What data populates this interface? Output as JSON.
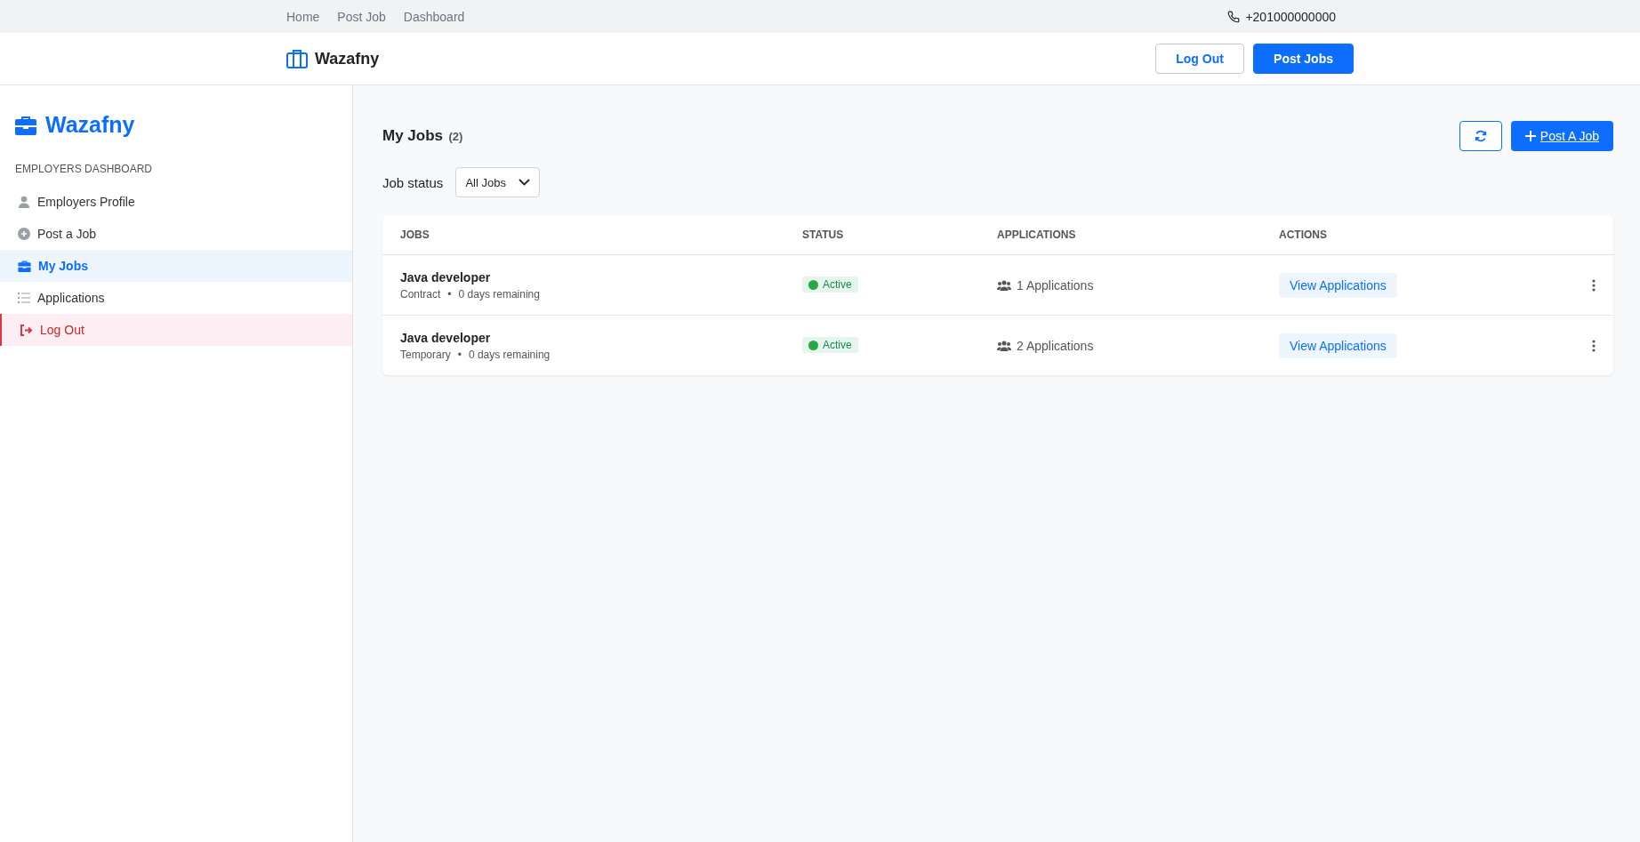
{
  "top_bar": {
    "links": [
      "Home",
      "Post Job",
      "Dashboard"
    ],
    "phone": "+201000000000"
  },
  "header": {
    "brand": "Wazafny",
    "buttons": [
      {
        "label": "Log Out",
        "kind": "outline"
      },
      {
        "label": "Post Jobs",
        "kind": "primary"
      }
    ]
  },
  "sidebar": {
    "brand": "Wazafny",
    "section": "EMPLOYERS DASHBOARD",
    "items": [
      {
        "label": "Employers Profile",
        "kind": "profile",
        "selected": false
      },
      {
        "label": "Post a Job",
        "kind": "post",
        "selected": false
      },
      {
        "label": "My Jobs",
        "kind": "jobs",
        "selected": true
      },
      {
        "label": "Applications",
        "kind": "applications",
        "selected": false
      },
      {
        "label": "Log Out",
        "kind": "logout",
        "selected": false
      }
    ]
  },
  "main": {
    "title": "My Jobs",
    "count": "(2)",
    "post_button": "Post A Job",
    "filter": {
      "label": "Job status",
      "value": "All Jobs"
    },
    "table": {
      "columns": [
        "JOBS",
        "STATUS",
        "APPLICATIONS",
        "ACTIONS"
      ],
      "rows": [
        {
          "title": "Java developer",
          "type": "Contract",
          "separator": "•",
          "remaining": "0 days remaining",
          "status": {
            "label": "Active",
            "kind": "active"
          },
          "applications": "1 Applications",
          "action": "View Applications"
        },
        {
          "title": "Java developer",
          "type": "Temporary",
          "separator": "•",
          "remaining": "0 days remaining",
          "status": {
            "label": "Active",
            "kind": "active"
          },
          "applications": "2 Applications",
          "action": "View Applications"
        }
      ]
    }
  }
}
